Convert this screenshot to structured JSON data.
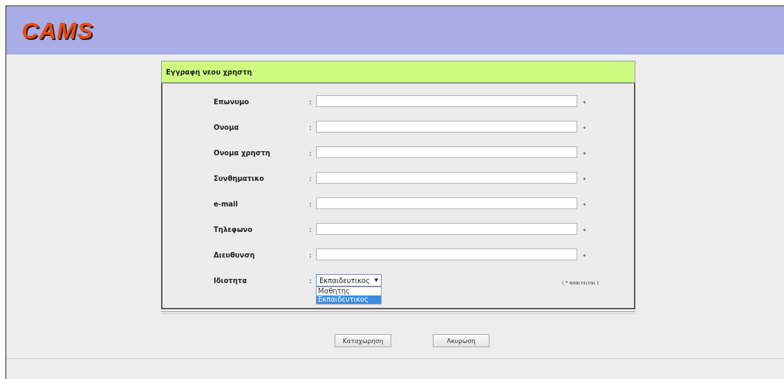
{
  "header": {
    "logo": "CAMS"
  },
  "form": {
    "title": "Εγγραφη νεου χρηστη",
    "fields": [
      {
        "kind": "text",
        "label": "Επωνυμο",
        "separator": ":",
        "required": true,
        "required_mark": "*"
      },
      {
        "kind": "text",
        "label": "Ονομα",
        "separator": ":",
        "required": true,
        "required_mark": "*"
      },
      {
        "kind": "text",
        "label": "Ονομα χρηστη",
        "separator": ":",
        "required": true,
        "required_mark": "*"
      },
      {
        "kind": "text",
        "label": "Συνθηματικο",
        "separator": ":",
        "required": true,
        "required_mark": "*"
      },
      {
        "kind": "text",
        "label": "e-mail",
        "separator": ":",
        "required": true,
        "required_mark": "*"
      },
      {
        "kind": "text",
        "label": "Τηλεφωνο",
        "separator": ":",
        "required": true,
        "required_mark": "*"
      },
      {
        "kind": "text",
        "label": "Διευθυνση",
        "separator": ":",
        "required": true,
        "required_mark": "*"
      },
      {
        "kind": "select",
        "label": "Ιδιοτητα",
        "separator": ":",
        "value": "Εκπαιδευτικος",
        "caret": "▼",
        "expanded": true,
        "options": [
          {
            "label": "Μαθητης",
            "selected": false
          },
          {
            "label": "Εκπαιδευτικος",
            "selected": true
          }
        ]
      }
    ],
    "required_note": "( * απαιτειται )"
  },
  "buttons": [
    "Καταχωρηση",
    "Ακυρωση"
  ]
}
